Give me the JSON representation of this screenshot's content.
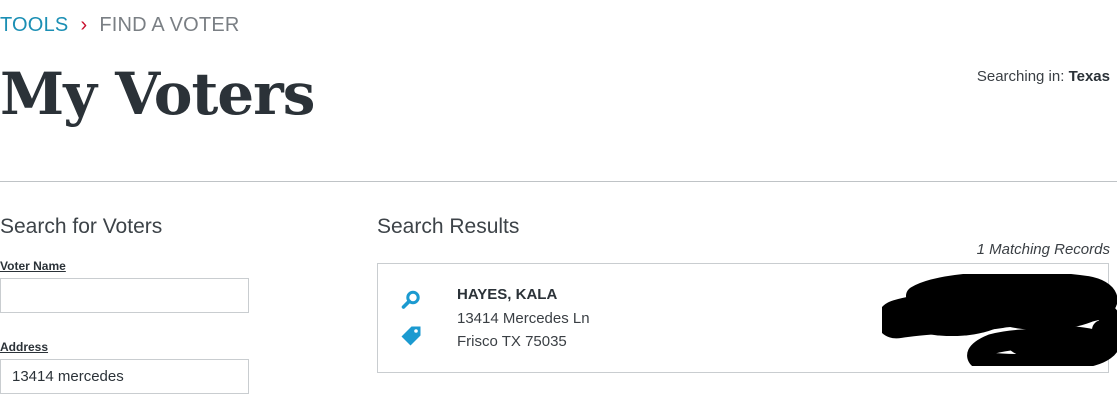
{
  "breadcrumb": {
    "root": "TOOLS",
    "separator": "›",
    "current": "FIND A VOTER"
  },
  "page": {
    "title": "My Voters",
    "searching_label": "Searching in: ",
    "searching_state": "Texas"
  },
  "search_form": {
    "heading": "Search for Voters",
    "name_label": "Voter Name",
    "name_value": "",
    "address_label": "Address",
    "address_value": "13414 mercedes"
  },
  "results": {
    "heading": "Search Results",
    "count_text": "1 Matching Records",
    "records": [
      {
        "name": "HAYES, KALA",
        "street": "13414 Mercedes Ln",
        "city_line": "Frisco TX 75035"
      }
    ]
  },
  "colors": {
    "link": "#1b8fb4",
    "separator": "#c8102e",
    "icon": "#1b9ad0",
    "text": "#2b3238"
  }
}
